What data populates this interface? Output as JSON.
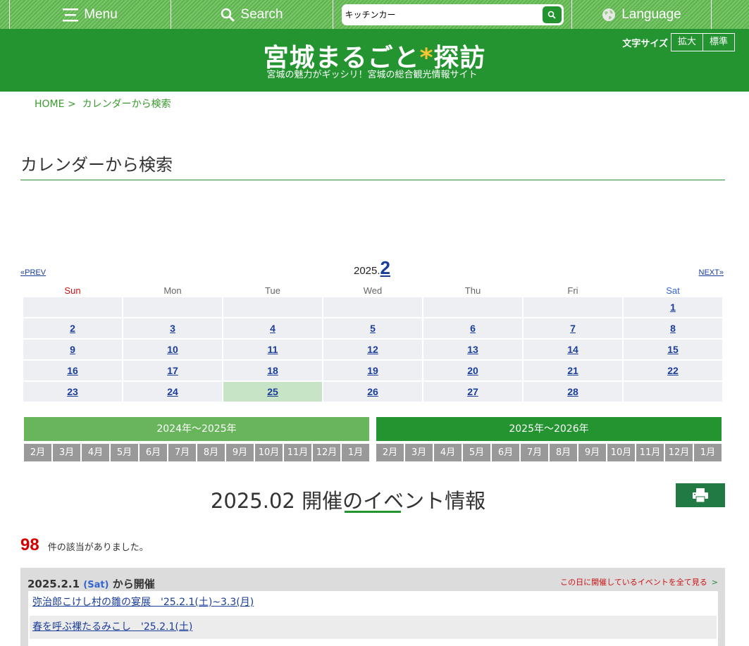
{
  "topnav": {
    "menu_label": "Menu",
    "search_label": "Search",
    "search_value": "キッチンカー",
    "language_label": "Language"
  },
  "header": {
    "logo_part1": "宮城まるごと",
    "logo_asterisk": "*",
    "logo_part2": "探訪",
    "tagline": "宮城の魅力がギッシリ！宮城の総合観光情報サイト",
    "fontsize_label": "文字サイズ",
    "fontsize_large": "拡大",
    "fontsize_normal": "標準"
  },
  "breadcrumb": {
    "home": "HOME",
    "separator": ">",
    "current": "カレンダーから検索"
  },
  "page_title": "カレンダーから検索",
  "calendar": {
    "prev_label": "«PREV",
    "next_label": "NEXT»",
    "year_prefix": "2025.",
    "month": "2",
    "weekdays": [
      "Sun",
      "Mon",
      "Tue",
      "Wed",
      "Thu",
      "Fri",
      "Sat"
    ],
    "today": "25",
    "weeks": [
      [
        "",
        "",
        "",
        "",
        "",
        "",
        "1"
      ],
      [
        "2",
        "3",
        "4",
        "5",
        "6",
        "7",
        "8"
      ],
      [
        "9",
        "10",
        "11",
        "12",
        "13",
        "14",
        "15"
      ],
      [
        "16",
        "17",
        "18",
        "19",
        "20",
        "21",
        "22"
      ],
      [
        "23",
        "24",
        "25",
        "26",
        "27",
        "28",
        ""
      ]
    ]
  },
  "year_tabs": [
    {
      "label": "2024年〜2025年",
      "months": [
        "2月",
        "3月",
        "4月",
        "5月",
        "6月",
        "7月",
        "8月",
        "9月",
        "10月",
        "11月",
        "12月",
        "1月"
      ]
    },
    {
      "label": "2025年〜2026年",
      "months": [
        "2月",
        "3月",
        "4月",
        "5月",
        "6月",
        "7月",
        "8月",
        "9月",
        "10月",
        "11月",
        "12月",
        "1月"
      ]
    }
  ],
  "events": {
    "title": "2025.02 開催のイベント情報",
    "count": "98",
    "count_text": "件の該当がありました。",
    "day_groups": [
      {
        "date": "2025.2.1",
        "dow": "(Sat)",
        "suffix": "から開催",
        "see_all": "この日に開催しているイベントを全て見る",
        "items": [
          "弥治郎こけし村の雛の宴展　'25.2.1(土)~3.3(月)",
          "春を呼ぶ裸たるみこし　'25.2.1(土)"
        ]
      }
    ]
  },
  "colors": {
    "brand_green": "#249431",
    "light_green": "#68b55c",
    "link_blue": "#1a3d9a",
    "count_red": "#d40000",
    "today_bg": "#c8e4c6"
  }
}
